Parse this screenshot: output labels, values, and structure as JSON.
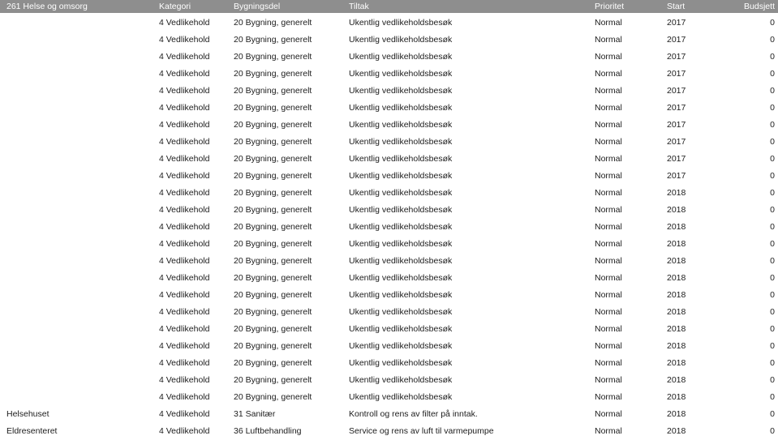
{
  "report": {
    "group_label": "261 Helse og omsorg",
    "columns": [
      {
        "key": "bygg",
        "label": ""
      },
      {
        "key": "kategori",
        "label": "Kategori"
      },
      {
        "key": "bygndel",
        "label": "Bygningsdel"
      },
      {
        "key": "tiltak",
        "label": "Tiltak"
      },
      {
        "key": "prioritet",
        "label": "Prioritet"
      },
      {
        "key": "start",
        "label": "Start"
      },
      {
        "key": "budsjett",
        "label": "Budsjett"
      }
    ],
    "header_background": "#8e8e8e",
    "header_text_color": "#ffffff",
    "rows": [
      {
        "bygg": "",
        "kategori": "4 Vedlikehold",
        "bygndel": "20 Bygning, generelt",
        "tiltak": "Ukentlig vedlikeholdsbesøk",
        "prioritet": "Normal",
        "start": "2017",
        "budsjett": "0"
      },
      {
        "bygg": "",
        "kategori": "4 Vedlikehold",
        "bygndel": "20 Bygning, generelt",
        "tiltak": "Ukentlig vedlikeholdsbesøk",
        "prioritet": "Normal",
        "start": "2017",
        "budsjett": "0"
      },
      {
        "bygg": "",
        "kategori": "4 Vedlikehold",
        "bygndel": "20 Bygning, generelt",
        "tiltak": "Ukentlig vedlikeholdsbesøk",
        "prioritet": "Normal",
        "start": "2017",
        "budsjett": "0"
      },
      {
        "bygg": "",
        "kategori": "4 Vedlikehold",
        "bygndel": "20 Bygning, generelt",
        "tiltak": "Ukentlig vedlikeholdsbesøk",
        "prioritet": "Normal",
        "start": "2017",
        "budsjett": "0"
      },
      {
        "bygg": "",
        "kategori": "4 Vedlikehold",
        "bygndel": "20 Bygning, generelt",
        "tiltak": "Ukentlig vedlikeholdsbesøk",
        "prioritet": "Normal",
        "start": "2017",
        "budsjett": "0"
      },
      {
        "bygg": "",
        "kategori": "4 Vedlikehold",
        "bygndel": "20 Bygning, generelt",
        "tiltak": "Ukentlig vedlikeholdsbesøk",
        "prioritet": "Normal",
        "start": "2017",
        "budsjett": "0"
      },
      {
        "bygg": "",
        "kategori": "4 Vedlikehold",
        "bygndel": "20 Bygning, generelt",
        "tiltak": "Ukentlig vedlikeholdsbesøk",
        "prioritet": "Normal",
        "start": "2017",
        "budsjett": "0"
      },
      {
        "bygg": "",
        "kategori": "4 Vedlikehold",
        "bygndel": "20 Bygning, generelt",
        "tiltak": "Ukentlig vedlikeholdsbesøk",
        "prioritet": "Normal",
        "start": "2017",
        "budsjett": "0"
      },
      {
        "bygg": "",
        "kategori": "4 Vedlikehold",
        "bygndel": "20 Bygning, generelt",
        "tiltak": "Ukentlig vedlikeholdsbesøk",
        "prioritet": "Normal",
        "start": "2017",
        "budsjett": "0"
      },
      {
        "bygg": "",
        "kategori": "4 Vedlikehold",
        "bygndel": "20 Bygning, generelt",
        "tiltak": "Ukentlig vedlikeholdsbesøk",
        "prioritet": "Normal",
        "start": "2017",
        "budsjett": "0"
      },
      {
        "bygg": "",
        "kategori": "4 Vedlikehold",
        "bygndel": "20 Bygning, generelt",
        "tiltak": "Ukentlig vedlikeholdsbesøk",
        "prioritet": "Normal",
        "start": "2018",
        "budsjett": "0"
      },
      {
        "bygg": "",
        "kategori": "4 Vedlikehold",
        "bygndel": "20 Bygning, generelt",
        "tiltak": "Ukentlig vedlikeholdsbesøk",
        "prioritet": "Normal",
        "start": "2018",
        "budsjett": "0"
      },
      {
        "bygg": "",
        "kategori": "4 Vedlikehold",
        "bygndel": "20 Bygning, generelt",
        "tiltak": "Ukentlig vedlikeholdsbesøk",
        "prioritet": "Normal",
        "start": "2018",
        "budsjett": "0"
      },
      {
        "bygg": "",
        "kategori": "4 Vedlikehold",
        "bygndel": "20 Bygning, generelt",
        "tiltak": "Ukentlig vedlikeholdsbesøk",
        "prioritet": "Normal",
        "start": "2018",
        "budsjett": "0"
      },
      {
        "bygg": "",
        "kategori": "4 Vedlikehold",
        "bygndel": "20 Bygning, generelt",
        "tiltak": "Ukentlig vedlikeholdsbesøk",
        "prioritet": "Normal",
        "start": "2018",
        "budsjett": "0"
      },
      {
        "bygg": "",
        "kategori": "4 Vedlikehold",
        "bygndel": "20 Bygning, generelt",
        "tiltak": "Ukentlig vedlikeholdsbesøk",
        "prioritet": "Normal",
        "start": "2018",
        "budsjett": "0"
      },
      {
        "bygg": "",
        "kategori": "4 Vedlikehold",
        "bygndel": "20 Bygning, generelt",
        "tiltak": "Ukentlig vedlikeholdsbesøk",
        "prioritet": "Normal",
        "start": "2018",
        "budsjett": "0"
      },
      {
        "bygg": "",
        "kategori": "4 Vedlikehold",
        "bygndel": "20 Bygning, generelt",
        "tiltak": "Ukentlig vedlikeholdsbesøk",
        "prioritet": "Normal",
        "start": "2018",
        "budsjett": "0"
      },
      {
        "bygg": "",
        "kategori": "4 Vedlikehold",
        "bygndel": "20 Bygning, generelt",
        "tiltak": "Ukentlig vedlikeholdsbesøk",
        "prioritet": "Normal",
        "start": "2018",
        "budsjett": "0"
      },
      {
        "bygg": "",
        "kategori": "4 Vedlikehold",
        "bygndel": "20 Bygning, generelt",
        "tiltak": "Ukentlig vedlikeholdsbesøk",
        "prioritet": "Normal",
        "start": "2018",
        "budsjett": "0"
      },
      {
        "bygg": "",
        "kategori": "4 Vedlikehold",
        "bygndel": "20 Bygning, generelt",
        "tiltak": "Ukentlig vedlikeholdsbesøk",
        "prioritet": "Normal",
        "start": "2018",
        "budsjett": "0"
      },
      {
        "bygg": "",
        "kategori": "4 Vedlikehold",
        "bygndel": "20 Bygning, generelt",
        "tiltak": "Ukentlig vedlikeholdsbesøk",
        "prioritet": "Normal",
        "start": "2018",
        "budsjett": "0"
      },
      {
        "bygg": "",
        "kategori": "4 Vedlikehold",
        "bygndel": "20 Bygning, generelt",
        "tiltak": "Ukentlig vedlikeholdsbesøk",
        "prioritet": "Normal",
        "start": "2018",
        "budsjett": "0"
      },
      {
        "bygg": "Helsehuset",
        "kategori": "4 Vedlikehold",
        "bygndel": "31 Sanitær",
        "tiltak": "Kontroll og rens av filter på inntak.",
        "prioritet": "Normal",
        "start": "2018",
        "budsjett": "0"
      },
      {
        "bygg": "Eldresenteret",
        "kategori": "4 Vedlikehold",
        "bygndel": "36 Luftbehandling",
        "tiltak": "Service og rens av luft til varmepumpe",
        "prioritet": "Normal",
        "start": "2018",
        "budsjett": "0"
      }
    ]
  }
}
